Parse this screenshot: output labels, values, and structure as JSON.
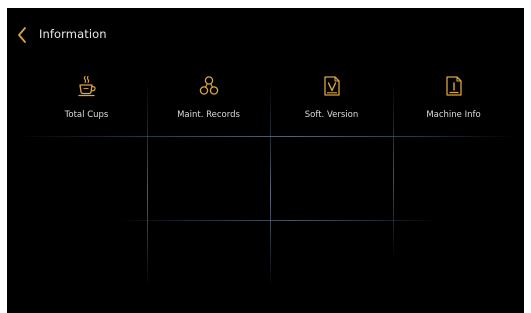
{
  "header": {
    "title": "Information"
  },
  "tiles": [
    {
      "label": "Total Cups",
      "icon": "coffee-cup-icon"
    },
    {
      "label": "Maint. Records",
      "icon": "maintenance-records-icon"
    },
    {
      "label": "Soft. Version",
      "icon": "software-version-icon"
    },
    {
      "label": "Machine Info",
      "icon": "machine-info-icon"
    }
  ],
  "colors": {
    "accent": "#d9a441",
    "background": "#000000",
    "text": "#e0e0e0",
    "grid": "#4a5a6e"
  }
}
